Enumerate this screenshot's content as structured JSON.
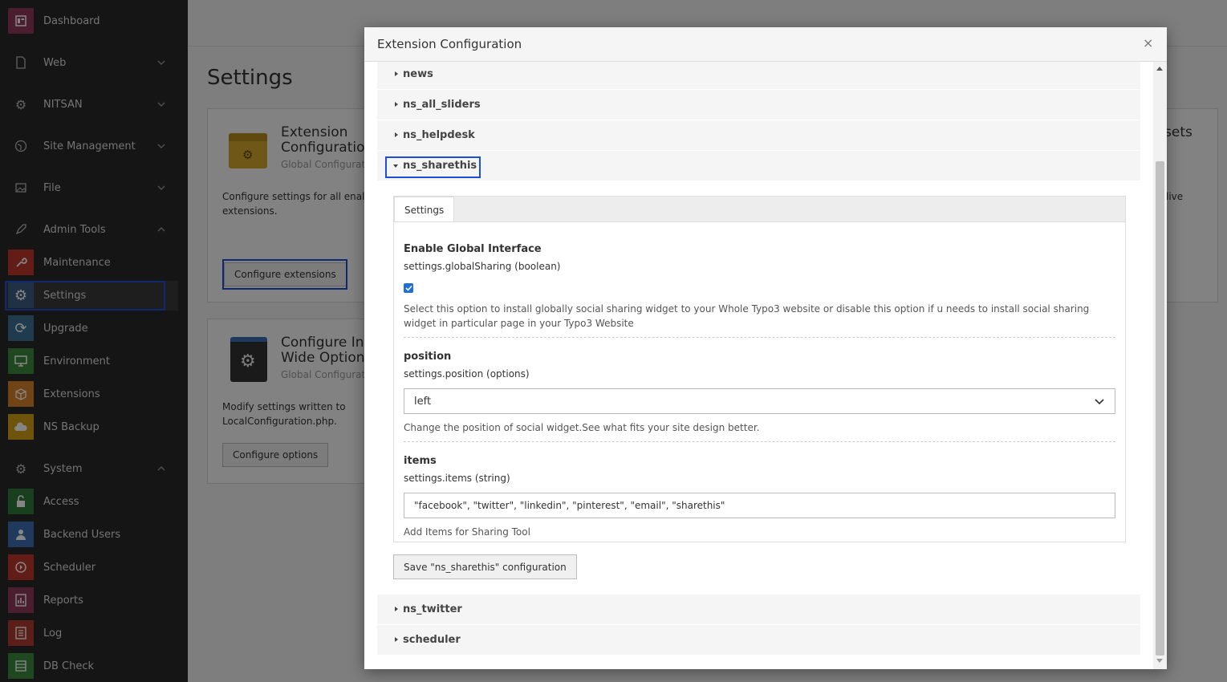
{
  "sidebar": {
    "top_items": [
      {
        "label": "Dashboard",
        "icon": "dashboard-icon",
        "chevron": ""
      },
      {
        "label": "Web",
        "icon": "page-icon",
        "chevron": "down"
      },
      {
        "label": "NITSAN",
        "icon": "gear-icon",
        "chevron": "down"
      },
      {
        "label": "Site Management",
        "icon": "globe-icon",
        "chevron": "down"
      },
      {
        "label": "File",
        "icon": "image-icon",
        "chevron": "down"
      }
    ],
    "admin_tools": {
      "label": "Admin Tools",
      "icon": "rocket-icon",
      "chevron": "up"
    },
    "admin_items": [
      {
        "label": "Maintenance",
        "icon": "wrench-icon",
        "color": "#c0392b"
      },
      {
        "label": "Settings",
        "icon": "settings-icon",
        "color": "#3f5e86"
      },
      {
        "label": "Upgrade",
        "icon": "refresh-icon",
        "color": "#3f6f96"
      },
      {
        "label": "Environment",
        "icon": "monitor-icon",
        "color": "#3e8a3e"
      },
      {
        "label": "Extensions",
        "icon": "box-icon",
        "color": "#d9822b"
      },
      {
        "label": "NS Backup",
        "icon": "cloud-icon",
        "color": "#d4a017"
      }
    ],
    "system": {
      "label": "System",
      "icon": "cog-icon",
      "chevron": "up"
    },
    "system_items": [
      {
        "label": "Access",
        "icon": "lock-icon",
        "color": "#2f7a3b"
      },
      {
        "label": "Backend Users",
        "icon": "user-icon",
        "color": "#3d6fb0"
      },
      {
        "label": "Scheduler",
        "icon": "clock-icon",
        "color": "#c0392b"
      },
      {
        "label": "Reports",
        "icon": "report-icon",
        "color": "#8e3b5a"
      },
      {
        "label": "Log",
        "icon": "log-icon",
        "color": "#b03a2e"
      },
      {
        "label": "DB Check",
        "icon": "database-icon",
        "color": "#3e8a3e"
      }
    ]
  },
  "background": {
    "title": "Settings",
    "card1": {
      "title": "Extension Configuration",
      "subtitle": "Global Configurat",
      "desc": "Configure settings for all enal extensions.",
      "button": "Configure extensions"
    },
    "card2": {
      "title": "Configure Ins Wide Options",
      "subtitle": "Global Configurat",
      "desc": "Modify settings written to LocalConfiguration.php.",
      "button": "Configure options"
    },
    "card3": {
      "title_fragment": "sets",
      "desc_fragment": "live"
    }
  },
  "modal": {
    "title": "Extension Configuration",
    "close": "×",
    "accordion": [
      {
        "name": "news",
        "expanded": false
      },
      {
        "name": "ns_all_sliders",
        "expanded": false
      },
      {
        "name": "ns_helpdesk",
        "expanded": false
      },
      {
        "name": "ns_sharethis",
        "expanded": true
      },
      {
        "name": "ns_twitter",
        "expanded": false
      },
      {
        "name": "scheduler",
        "expanded": false
      }
    ],
    "tab": "Settings",
    "fields": {
      "global": {
        "heading": "Enable Global Interface",
        "key": "settings.globalSharing (boolean)",
        "checked": true,
        "desc": "Select this option to install globally social sharing widget to your Whole Typo3 website or disable this option if u needs to install social sharing widget in particular page in your Typo3 Website"
      },
      "position": {
        "heading": "position",
        "key": "settings.position (options)",
        "value": "left",
        "desc": "Change the position of social widget.See what fits your site design better."
      },
      "items": {
        "heading": "items",
        "key": "settings.items (string)",
        "value": "\"facebook\", \"twitter\", \"linkedin\", \"pinterest\", \"email\", \"sharethis\"",
        "desc": "Add Items for Sharing Tool"
      }
    },
    "save_button": "Save \"ns_sharethis\" configuration"
  }
}
